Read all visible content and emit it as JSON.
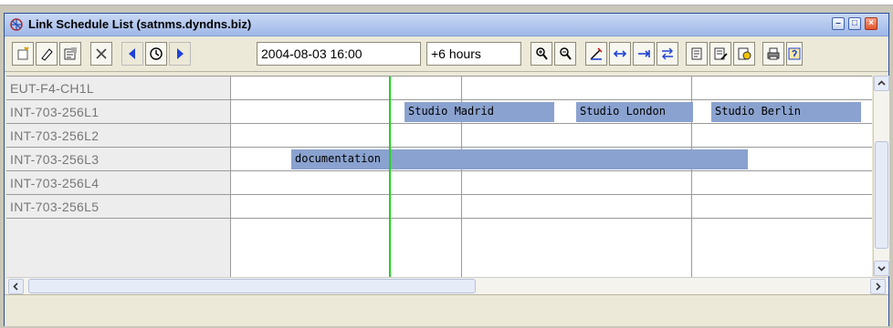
{
  "window": {
    "title": "Link Schedule List (satnms.dyndns.biz)"
  },
  "toolbar": {
    "date_value": "2004-08-03 16:00",
    "duration_value": "+6 hours"
  },
  "schedule": {
    "rows": [
      {
        "label": "EUT-F4-CH1L"
      },
      {
        "label": "INT-703-256L1"
      },
      {
        "label": "INT-703-256L2"
      },
      {
        "label": "INT-703-256L3"
      },
      {
        "label": "INT-703-256L4"
      },
      {
        "label": "INT-703-256L5"
      }
    ],
    "bookings": [
      {
        "label": "Studio Madrid",
        "row": "INT-703-256L1"
      },
      {
        "label": "Studio London",
        "row": "INT-703-256L1"
      },
      {
        "label": "Studio Berlin",
        "row": "INT-703-256L1"
      },
      {
        "label": "documentation",
        "row": "INT-703-256L3"
      }
    ]
  },
  "colors": {
    "booking_bar": "#8aa2cf",
    "now_line": "#22d322",
    "label_text": "#777777"
  },
  "icons": [
    "new-entry-icon",
    "edit-icon",
    "properties-icon",
    "delete-icon",
    "back-icon",
    "now-clock-icon",
    "forward-icon",
    "zoom-in-icon",
    "zoom-out-icon",
    "pen-icon",
    "expand-icon",
    "shift-right-icon",
    "swap-icon",
    "report-icon",
    "report-edit-icon",
    "refresh-icon",
    "print-icon",
    "help-icon"
  ]
}
